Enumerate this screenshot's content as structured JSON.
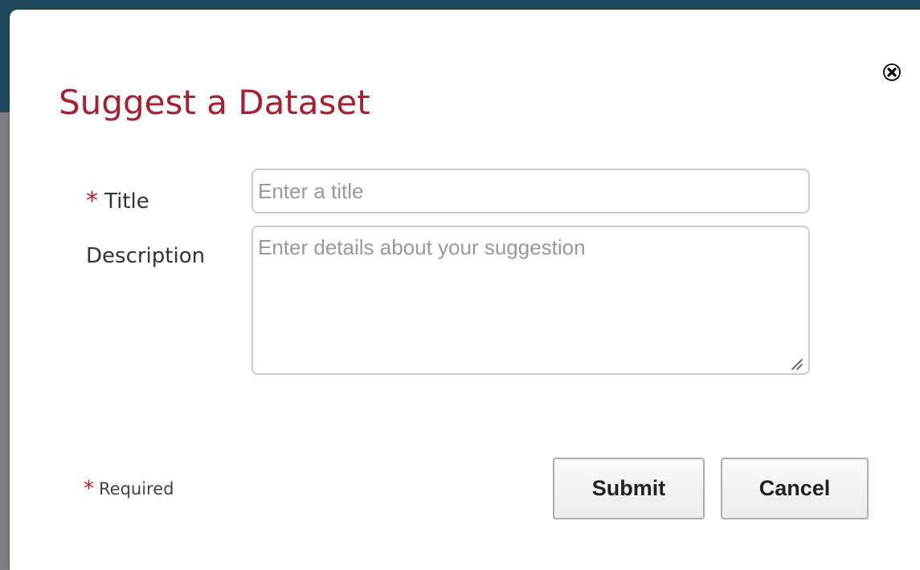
{
  "dialog": {
    "title": "Suggest a Dataset",
    "close_icon": "close-circle-icon"
  },
  "form": {
    "title_field": {
      "required_mark": "*",
      "label": "Title",
      "placeholder": "Enter a title",
      "value": ""
    },
    "description_field": {
      "label": "Description",
      "placeholder": "Enter details about your suggestion",
      "value": ""
    },
    "required_note": {
      "mark": "*",
      "text": "Required"
    }
  },
  "actions": {
    "submit_label": "Submit",
    "cancel_label": "Cancel"
  },
  "colors": {
    "title": "#a8202f",
    "required_star": "#c0182b",
    "backdrop": "#1f4a5c"
  }
}
